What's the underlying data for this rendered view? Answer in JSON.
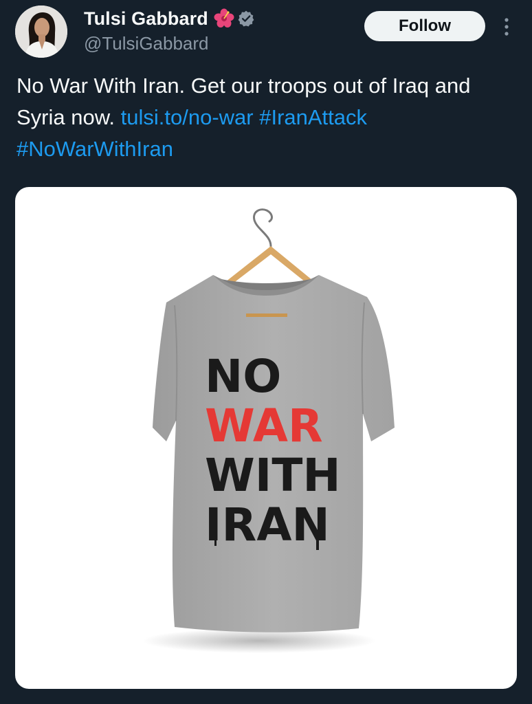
{
  "author": {
    "display_name": "Tulsi Gabbard",
    "handle": "@TulsiGabbard",
    "name_emoji": "hibiscus-flower-icon",
    "verified_badge": "verified-badge-icon",
    "verified_color": "#8b98a5"
  },
  "actions": {
    "follow_label": "Follow",
    "more_icon": "more-vertical-icon"
  },
  "tweet": {
    "text_part1": "No War With Iran. Get our troops out of Iraq and Syria now. ",
    "link": "tulsi.to/no-war",
    "hashtag1": "#IranAttack",
    "hashtag2": "#NoWarWithIran"
  },
  "media": {
    "shirt_text": {
      "line1": "NO",
      "line2": "WAR",
      "line3": "WITH",
      "line4": "IRAN"
    },
    "colors": {
      "shirt": "#a9a9a9",
      "text_black": "#1a1a1a",
      "text_red": "#e53935",
      "hanger": "#d9a866"
    }
  },
  "theme": {
    "background": "#15202b",
    "link_color": "#1d9bf0",
    "secondary_text": "#8b98a5"
  }
}
